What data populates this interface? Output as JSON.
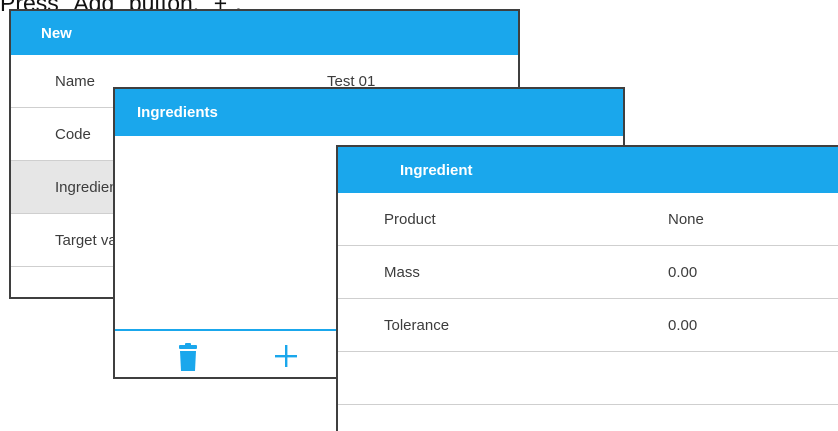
{
  "caption": "Press \"Add\" button, \"+\".",
  "new_window": {
    "title": "New",
    "rows": [
      {
        "label": "Name",
        "value": "Test 01"
      },
      {
        "label": "Code",
        "value": ""
      },
      {
        "label": "Ingredients",
        "value": ""
      },
      {
        "label": "Target value",
        "value": ""
      }
    ]
  },
  "ingredients_window": {
    "title": "Ingredients",
    "toolbar": {
      "delete_icon": "trash-icon",
      "add_icon": "plus-icon"
    }
  },
  "ingredient_window": {
    "title": "Ingredient",
    "rows": [
      {
        "label": "Product",
        "value": "None"
      },
      {
        "label": "Mass",
        "value": "0.00"
      },
      {
        "label": "Tolerance",
        "value": "0.00"
      }
    ]
  },
  "colors": {
    "header": "#1aa7ec",
    "border": "#3f3f3f",
    "selected_row": "#e6e6e6"
  }
}
